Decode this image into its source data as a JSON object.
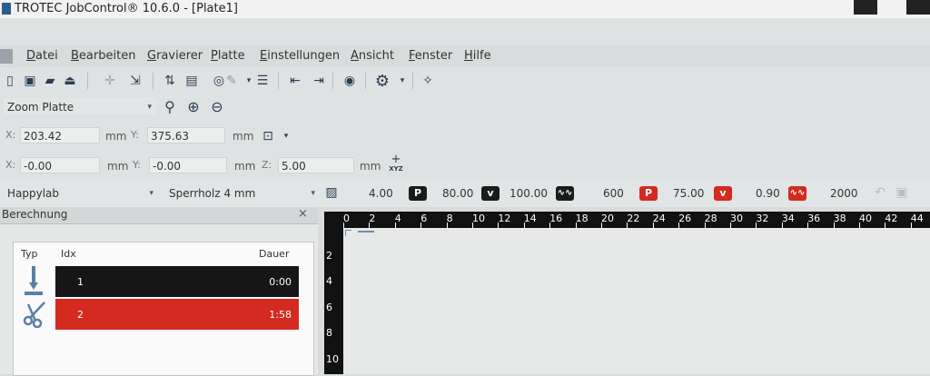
{
  "window": {
    "title": "TROTEC JobControl® 10.6.0 - [Plate1]"
  },
  "menu": [
    "Datei",
    "Bearbeiten",
    "Gravierer",
    "Platte",
    "Einstellungen",
    "Ansicht",
    "Fenster",
    "Hilfe"
  ],
  "zoom": {
    "selected": "Zoom Platte"
  },
  "coords": {
    "x_label": "X:",
    "x_value": "203.42",
    "x_unit": "mm",
    "y_label": "Y:",
    "y_value": "375.63",
    "y_unit": "mm"
  },
  "offsets": {
    "x_label": "X:",
    "x_value": "-0.00",
    "x_unit": "mm",
    "y_label": "Y:",
    "y_value": "-0.00",
    "y_unit": "mm",
    "z_label": "Z:",
    "z_value": "5.00",
    "z_unit": "mm",
    "xyz_label": "XYZ"
  },
  "material": {
    "profile": "Happylab",
    "material": "Sperrholz 4 mm",
    "thickness": "4.00",
    "engrave_power": "80.00",
    "engrave_velocity": "100.00",
    "engrave_ppi": "600",
    "cut_power": "75.00",
    "cut_velocity": "0.90",
    "cut_frequency": "2000",
    "badge_p": "P",
    "badge_v": "v"
  },
  "panel": {
    "title": "Berechnung",
    "close": "×",
    "columns": {
      "type": "Typ",
      "idx": "Idx",
      "duration": "Dauer"
    },
    "rows": [
      {
        "idx": "1",
        "duration": "0:00",
        "color": "#161616"
      },
      {
        "idx": "2",
        "duration": "1:58",
        "color": "#d42a1f"
      }
    ]
  },
  "ruler": {
    "top_labels": [
      "0",
      "2",
      "4",
      "6",
      "8",
      "10",
      "12",
      "14",
      "16",
      "18",
      "20",
      "22",
      "24",
      "26",
      "28",
      "30",
      "32",
      "34",
      "36",
      "38",
      "40",
      "42",
      "44"
    ],
    "left_labels": [
      "2",
      "4",
      "6",
      "8",
      "10"
    ]
  }
}
